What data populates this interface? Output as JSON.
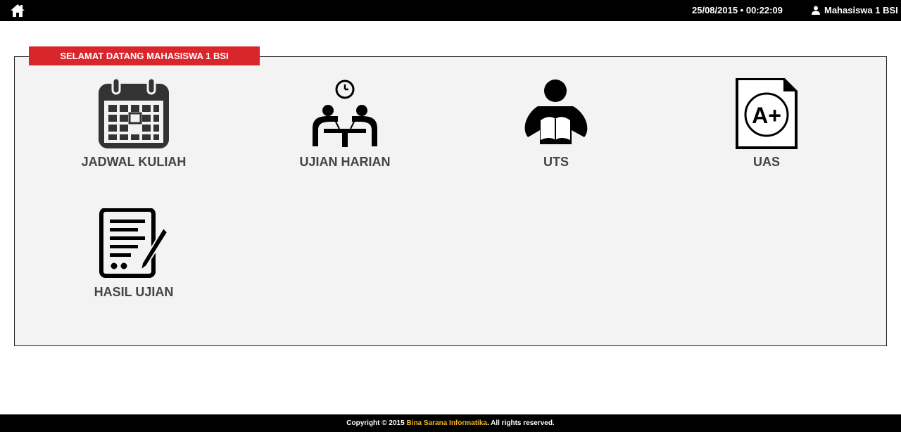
{
  "header": {
    "datetime": "25/08/2015 • 00:22:09",
    "user_name": "Mahasiswa 1 BSI",
    "home_icon": "home-icon",
    "user_icon": "user-icon"
  },
  "panel": {
    "title": "SELAMAT DATANG MAHASISWA 1 BSI",
    "title_color": "#d9262c"
  },
  "menu": [
    {
      "label": "JADWAL KULIAH",
      "icon": "calendar-icon"
    },
    {
      "label": "UJIAN HARIAN",
      "icon": "meeting-clock-icon"
    },
    {
      "label": "UTS",
      "icon": "reading-person-icon"
    },
    {
      "label": "UAS",
      "icon": "grade-a-plus-icon"
    },
    {
      "label": "HASIL UJIAN",
      "icon": "document-pen-icon"
    }
  ],
  "footer": {
    "prefix": "Copyright © 2015 ",
    "brand": "Bina Sarana Informatika",
    "suffix": ". All rights reserved.",
    "brand_color": "#f0b429"
  }
}
